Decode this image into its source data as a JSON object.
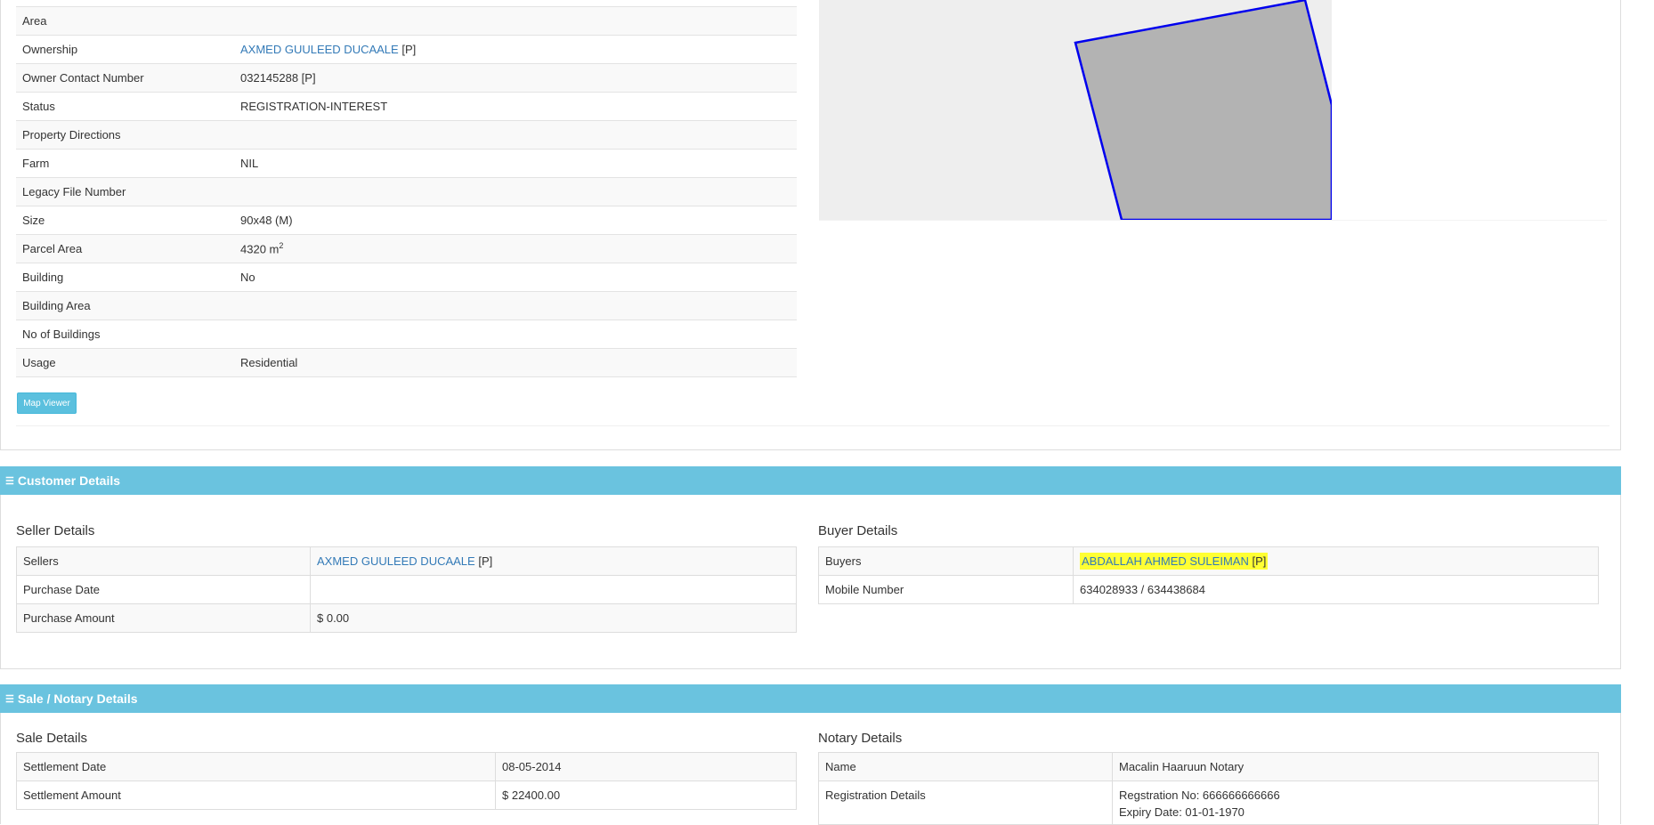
{
  "property": {
    "rows": [
      {
        "label": "Area",
        "value": ""
      },
      {
        "label": "Ownership",
        "value_link": "AXMED GUULEED DUCAALE",
        "suffix": "[P]"
      },
      {
        "label": "Owner Contact Number",
        "value": "032145288 [P]"
      },
      {
        "label": "Status",
        "value": "REGISTRATION-INTEREST"
      },
      {
        "label": "Property Directions",
        "value": ""
      },
      {
        "label": "Farm",
        "value": "NIL"
      },
      {
        "label": "Legacy File Number",
        "value": ""
      },
      {
        "label": "Size",
        "value": "90x48 (M)"
      },
      {
        "label": "Parcel Area",
        "value": "4320 m",
        "sup": "2"
      },
      {
        "label": "Building",
        "value": "No"
      },
      {
        "label": "Building Area",
        "value": ""
      },
      {
        "label": "No of Buildings",
        "value": ""
      },
      {
        "label": "Usage",
        "value": "Residential"
      }
    ],
    "map_viewer_label": "Map Viewer",
    "map": {
      "background": "#eeeeee",
      "parcel_fill": "#b3b3b3",
      "parcel_stroke": "#0000ee"
    }
  },
  "customer": {
    "section_title": "Customer Details",
    "seller_title": "Seller Details",
    "seller_rows": [
      {
        "label": "Sellers",
        "value_link": "AXMED GUULEED DUCAALE",
        "suffix": "[P]"
      },
      {
        "label": "Purchase Date",
        "value": ""
      },
      {
        "label": "Purchase Amount",
        "value": "$ 0.00"
      }
    ],
    "buyer_title": "Buyer Details",
    "buyer_rows": [
      {
        "label": "Buyers",
        "value_link": "ABDALLAH AHMED SULEIMAN",
        "suffix": "[P]",
        "highlight": "#ffff33"
      },
      {
        "label": "Mobile Number",
        "value": "634028933 / 634438684"
      }
    ]
  },
  "sale": {
    "section_title": "Sale / Notary Details",
    "sale_title": "Sale Details",
    "sale_rows": [
      {
        "label": "Settlement Date",
        "value": "08-05-2014"
      },
      {
        "label": "Settlement Amount",
        "value": "$ 22400.00"
      }
    ],
    "notary_title": "Notary Details",
    "notary_rows": [
      {
        "label": "Name",
        "value": "Macalin Haaruun Notary"
      },
      {
        "label": "Registration Details",
        "line1": "Regstration No: 666666666666",
        "line2": "Expiry Date: 01-01-1970"
      }
    ]
  },
  "colors": {
    "section_header": "#6ac3df",
    "link": "#337ab7",
    "button": "#5bc0de"
  }
}
